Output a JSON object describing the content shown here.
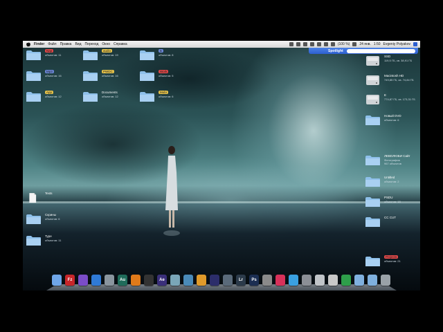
{
  "menubar": {
    "menus": [
      "Finder",
      "Файл",
      "Правка",
      "Вид",
      "Переход",
      "Окно",
      "Справка"
    ],
    "status_time": "1:50",
    "status_day": "24 янв.",
    "status_user": "Evgeniy Polyakov",
    "status_battery": "(100 %)"
  },
  "spotlight": {
    "label": "Spotlight",
    "placeholder": ""
  },
  "left_icons": [
    {
      "name": "Nap",
      "sub": "объектов: 11",
      "tag": "#e04848"
    },
    {
      "name": "audio",
      "sub": "объектов: 19",
      "tag": "#e6c34a"
    },
    {
      "name": "Б",
      "sub": "объектов: 8",
      "tag": "#6a86d6"
    },
    {
      "name": "Mp3",
      "sub": "объектов: 16",
      "tag": "#6a86d6"
    },
    {
      "name": "PWDC",
      "sub": "объектов: 16",
      "tag": "#e6c34a"
    },
    {
      "name": "Work",
      "sub": "объектов: 5",
      "tag": "#e04848"
    },
    {
      "name": "App",
      "sub": "объектов: 12",
      "tag": "#e6c34a"
    },
    {
      "name": "Documents",
      "sub": "объектов: 12",
      "tag": ""
    },
    {
      "name": "Mobi",
      "sub": "объектов: 6",
      "tag": "#e6c34a"
    },
    {
      "name": "Texts",
      "sub": "",
      "tag": "",
      "doc": true
    },
    {
      "name": "Скрины",
      "sub": "объектов: 6",
      "tag": ""
    },
    {
      "name": "Type",
      "sub": "объектов: 11",
      "tag": ""
    }
  ],
  "right_icons": [
    {
      "name": "SSD",
      "sub": "119,5 ГБ, св. 38,91 ГБ"
    },
    {
      "name": "Macintosh HD",
      "sub": "749,85 ГБ, св. 74,84 ГБ"
    },
    {
      "name": "E",
      "sub": "774,87 ГБ, св. 173,31 ГБ"
    },
    {
      "name": "Новый DVD",
      "sub": "объектов: 6"
    },
    {
      "name": "ЛЕВОЛЮБИ Сайт",
      "sub": "Фотография",
      "sub2": "967 объектов"
    },
    {
      "name": "Untitled",
      "sub": "объектов: 2"
    },
    {
      "name": "PSDU",
      "sub": "объектов: 18"
    },
    {
      "name": "CC CUT",
      "sub": ""
    },
    {
      "name": "Projects",
      "sub": "объектов: 21",
      "tag": "#e04848"
    }
  ],
  "dock": [
    {
      "icon": "finder-icon",
      "label": "",
      "color": "#6fa6e8"
    },
    {
      "icon": "filezilla-icon",
      "label": "Fz",
      "color": "#c7262a"
    },
    {
      "icon": "nova-icon",
      "label": "",
      "color": "#7a4cc8"
    },
    {
      "icon": "safari-icon",
      "label": "",
      "color": "#2f7ad6"
    },
    {
      "icon": "drive-icon",
      "label": "",
      "color": "#8a959e"
    },
    {
      "icon": "audition-icon",
      "label": "Au",
      "color": "#1f6b5a"
    },
    {
      "icon": "vlc-icon",
      "label": "",
      "color": "#e07a1a"
    },
    {
      "icon": "clapper-icon",
      "label": "",
      "color": "#333333"
    },
    {
      "icon": "after-effects-icon",
      "label": "Ae",
      "color": "#3a2f7a"
    },
    {
      "icon": "globe-icon",
      "label": "",
      "color": "#7aa6b8"
    },
    {
      "icon": "pen-icon",
      "label": "",
      "color": "#4a8ab8"
    },
    {
      "icon": "orange-icon",
      "label": "",
      "color": "#e09a2a"
    },
    {
      "icon": "premiere-icon",
      "label": "",
      "color": "#2c2d6a"
    },
    {
      "icon": "imovie-icon",
      "label": "",
      "color": "#5a6a7a"
    },
    {
      "icon": "lightroom-icon",
      "label": "Lr",
      "color": "#2b3a4a"
    },
    {
      "icon": "photoshop-icon",
      "label": "Ps",
      "color": "#1b2e52"
    },
    {
      "icon": "tool-icon",
      "label": "",
      "color": "#8a8a8a"
    },
    {
      "icon": "itunes-icon",
      "label": "",
      "color": "#d8315a"
    },
    {
      "icon": "twitter-icon",
      "label": "",
      "color": "#3aa0e0"
    },
    {
      "icon": "preferences-icon",
      "label": "",
      "color": "#8b8f96"
    },
    {
      "icon": "timer-icon",
      "label": "",
      "color": "#c0c4c8"
    },
    {
      "icon": "app-store-icon",
      "label": "",
      "color": "#c8c8c8"
    },
    {
      "icon": "utorrent-icon",
      "label": "",
      "color": "#2e9e4a"
    },
    {
      "icon": "folder-icon",
      "label": "",
      "color": "#7fb0de"
    },
    {
      "icon": "folder-icon",
      "label": "",
      "color": "#7fb0de"
    },
    {
      "icon": "trash-icon",
      "label": "",
      "color": "#9aa2a8"
    }
  ]
}
